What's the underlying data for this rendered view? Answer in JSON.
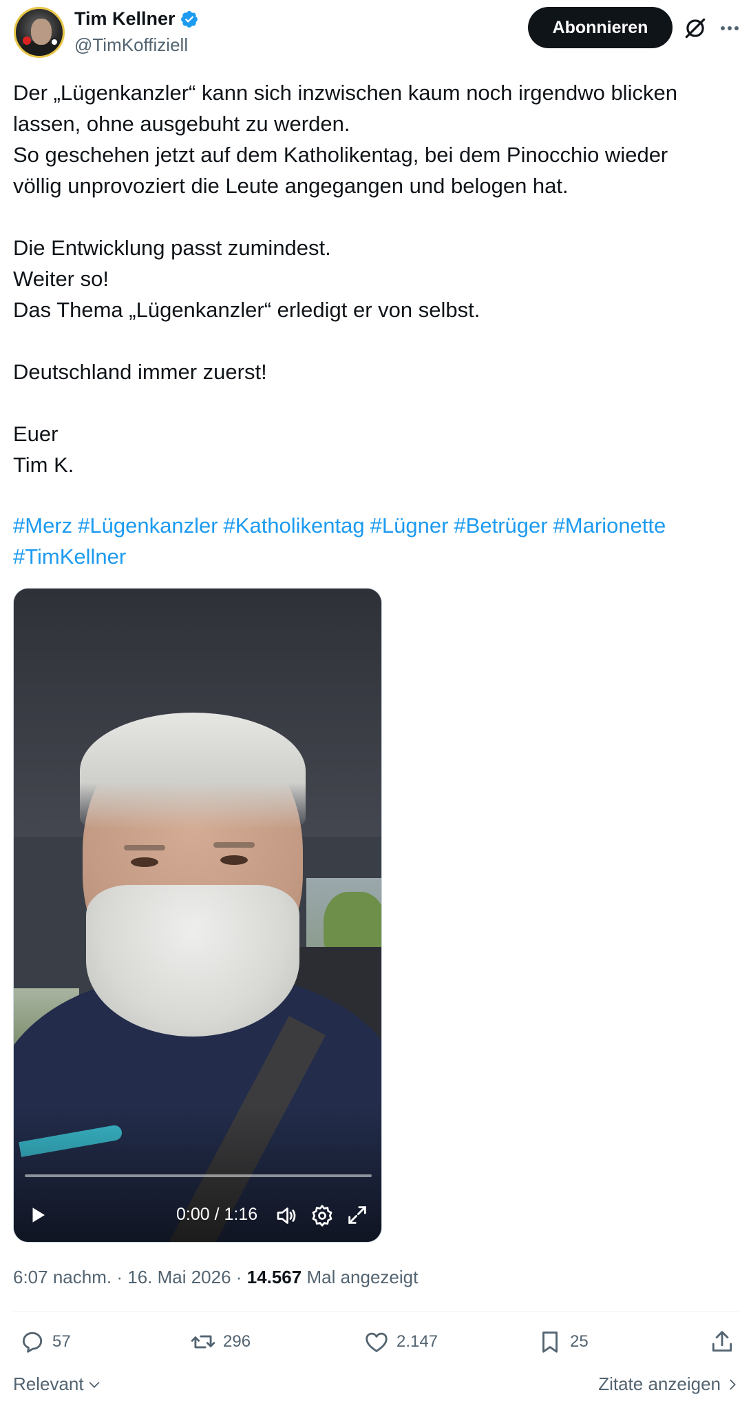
{
  "author": {
    "display_name": "Tim Kellner",
    "handle": "@TimKoffiziell",
    "verified": true
  },
  "header": {
    "subscribe_label": "Abonnieren",
    "icons": [
      "grok-icon",
      "more-icon"
    ]
  },
  "tweet": {
    "lines": [
      "Der „Lügenkanzler“ kann sich inzwischen kaum noch irgendwo blicken",
      "lassen, ohne ausgebuht zu werden.",
      "So geschehen jetzt auf dem Katholikentag, bei dem Pinocchio wieder",
      "völlig unprovoziert die Leute angegangen und belogen hat.",
      "",
      "Die Entwicklung passt zumindest.",
      "Weiter so!",
      "Das Thema „Lügenkanzler“ erledigt er von selbst.",
      "",
      "Deutschland immer zuerst!",
      "",
      "Euer",
      "Tim K."
    ],
    "hashtags": [
      "#Merz",
      "#Lügenkanzler",
      "#Katholikentag",
      "#Lügner",
      "#Betrüger",
      "#Marionette",
      "#TimKellner"
    ]
  },
  "video": {
    "time": "0:00 / 1:16",
    "progress": 0
  },
  "meta": {
    "time": "6:07 nachm.",
    "separator": "·",
    "date": "16. Mai 2026",
    "views": "14.567",
    "views_label": "Mal angezeigt"
  },
  "actions": {
    "replies": "57",
    "reposts": "296",
    "likes": "2.147",
    "bookmarks": "25"
  },
  "footer": {
    "sort_label": "Relevant",
    "quotes_label": "Zitate anzeigen"
  },
  "colors": {
    "accent": "#1d9bf0",
    "text": "#0f1419",
    "muted": "#536471"
  }
}
